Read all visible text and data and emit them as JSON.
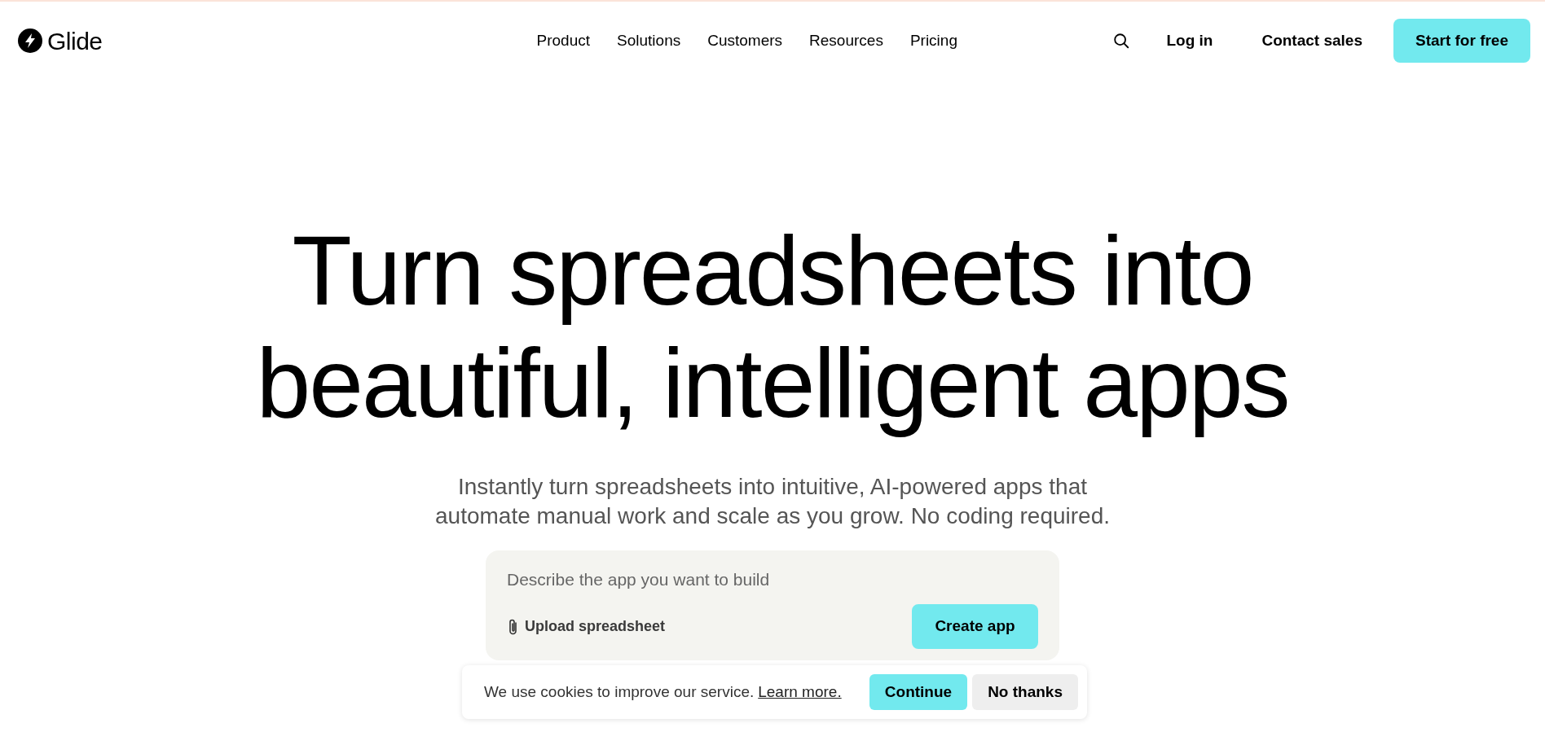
{
  "header": {
    "logo": "Glide",
    "nav": [
      "Product",
      "Solutions",
      "Customers",
      "Resources",
      "Pricing"
    ],
    "login": "Log in",
    "contact": "Contact sales",
    "cta": "Start for free"
  },
  "hero": {
    "title_lines": [
      "Turn spreadsheets into",
      "beautiful, intelligent apps"
    ],
    "subtitle_lines": [
      "Instantly turn spreadsheets into intuitive, AI-powered apps that",
      "automate manual work and scale as you grow. No coding required."
    ]
  },
  "prompt": {
    "placeholder": "Describe the app you want to build",
    "upload": "Upload spreadsheet",
    "create": "Create app"
  },
  "cookie": {
    "text": "We use cookies to improve our service.",
    "link": "Learn more.",
    "accept": "Continue",
    "decline": "No thanks"
  }
}
